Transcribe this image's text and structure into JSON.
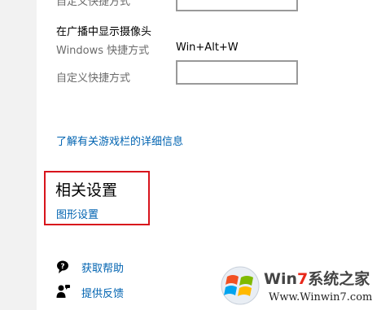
{
  "settings": {
    "broadcast_camera_heading": "在广播中显示摄像头",
    "windows_shortcut_label": "Windows 快捷方式",
    "windows_shortcut_value": "Win+Alt+W",
    "custom_shortcut_label": "自定义快捷方式",
    "custom_shortcut_value": "",
    "learn_more_link": "了解有关游戏栏的详细信息"
  },
  "related": {
    "title": "相关设置",
    "graphics_link": "图形设置"
  },
  "help": {
    "get_help": "获取帮助",
    "give_feedback": "提供反馈"
  },
  "watermark": {
    "title_prefix": "Win",
    "title_seven": "7",
    "title_suffix": "系统之家",
    "url": "Www.Winwin7.com"
  },
  "colors": {
    "link": "#0063b1",
    "highlight_border": "#d8141c"
  }
}
